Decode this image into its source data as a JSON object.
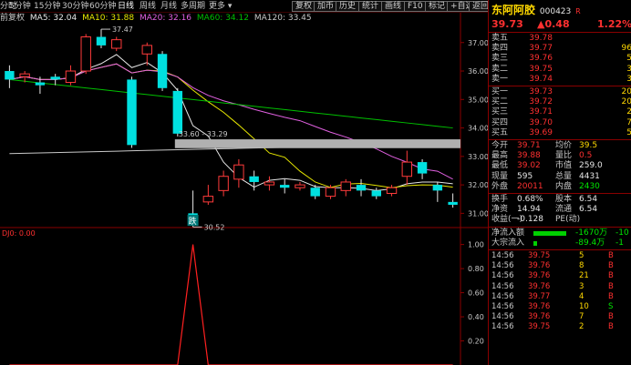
{
  "toolbar": {
    "periods": [
      "分时",
      "5分钟",
      "15分钟",
      "30分钟",
      "60分钟",
      "日线",
      "周线",
      "月线",
      "多周期",
      "更多"
    ],
    "active_period": "日线",
    "buttons": [
      "复权",
      "加币",
      "历史",
      "统计",
      "画线",
      "F10",
      "标记",
      "+自选",
      "返回"
    ]
  },
  "legend": {
    "prefix": "前复权",
    "ma5": "MA5: 32.04",
    "ma10": "MA10: 31.88",
    "ma20": "MA20: 32.16",
    "ma60": "MA60: 34.12",
    "ma120": "MA120: 33.45",
    "colors": {
      "ma5": "#e6e6e6",
      "ma10": "#e6e600",
      "ma20": "#e060e0",
      "ma60": "#00c000",
      "ma120": "#c8c8c8"
    }
  },
  "chart": {
    "price_ticks": [
      "37.00",
      "36.00",
      "35.00",
      "34.00",
      "33.00",
      "32.00",
      "31.00"
    ],
    "annotations": {
      "high": "37.47",
      "range": "33.60 - 33.29",
      "low": "30.52",
      "low_tag": "跌"
    },
    "sub_label": "DJ0: 0.00",
    "sub_ticks": [
      "1.00",
      "0.80",
      "0.60",
      "0.40",
      "0.20"
    ]
  },
  "chart_data": [
    {
      "type": "candlestick",
      "ylim": [
        30.5,
        37.6
      ],
      "candles": [
        {
          "o": 36.0,
          "c": 35.7,
          "h": 36.2,
          "l": 35.4
        },
        {
          "o": 35.8,
          "c": 35.9,
          "h": 36.0,
          "l": 35.6
        },
        {
          "o": 35.6,
          "c": 35.5,
          "h": 35.8,
          "l": 35.2
        },
        {
          "o": 35.8,
          "c": 35.7,
          "h": 35.9,
          "l": 35.5
        },
        {
          "o": 35.6,
          "c": 36.0,
          "h": 36.2,
          "l": 35.5
        },
        {
          "o": 36.0,
          "c": 37.2,
          "h": 37.3,
          "l": 35.9
        },
        {
          "o": 37.2,
          "c": 36.9,
          "h": 37.47,
          "l": 36.8
        },
        {
          "o": 36.8,
          "c": 37.1,
          "h": 37.2,
          "l": 36.7
        },
        {
          "o": 35.7,
          "c": 33.4,
          "h": 35.8,
          "l": 33.3
        },
        {
          "o": 36.6,
          "c": 36.9,
          "h": 37.0,
          "l": 36.2
        },
        {
          "o": 36.6,
          "c": 35.4,
          "h": 36.7,
          "l": 35.3
        },
        {
          "o": 35.3,
          "c": 33.8,
          "h": 35.4,
          "l": 33.7
        },
        {
          "o": 31.0,
          "c": 30.9,
          "h": 31.8,
          "l": 30.52
        },
        {
          "o": 31.4,
          "c": 31.6,
          "h": 32.0,
          "l": 31.3
        },
        {
          "o": 31.8,
          "c": 32.3,
          "h": 32.5,
          "l": 31.6
        },
        {
          "o": 32.2,
          "c": 32.7,
          "h": 32.9,
          "l": 31.9
        },
        {
          "o": 32.3,
          "c": 32.1,
          "h": 32.5,
          "l": 31.8
        },
        {
          "o": 32.0,
          "c": 32.1,
          "h": 32.3,
          "l": 31.8
        },
        {
          "o": 32.0,
          "c": 31.9,
          "h": 32.2,
          "l": 31.7
        },
        {
          "o": 31.9,
          "c": 32.0,
          "h": 32.1,
          "l": 31.8
        },
        {
          "o": 31.9,
          "c": 31.6,
          "h": 32.0,
          "l": 31.5
        },
        {
          "o": 31.6,
          "c": 31.9,
          "h": 32.0,
          "l": 31.5
        },
        {
          "o": 31.8,
          "c": 32.1,
          "h": 32.2,
          "l": 31.6
        },
        {
          "o": 32.0,
          "c": 31.8,
          "h": 32.2,
          "l": 31.6
        },
        {
          "o": 31.8,
          "c": 31.6,
          "h": 31.9,
          "l": 31.5
        },
        {
          "o": 31.7,
          "c": 31.9,
          "h": 32.0,
          "l": 31.6
        },
        {
          "o": 32.3,
          "c": 32.8,
          "h": 33.2,
          "l": 32.0
        },
        {
          "o": 32.8,
          "c": 32.4,
          "h": 32.9,
          "l": 32.2
        },
        {
          "o": 32.0,
          "c": 31.8,
          "h": 32.1,
          "l": 31.4
        },
        {
          "o": 31.4,
          "c": 31.3,
          "h": 31.7,
          "l": 31.2
        }
      ]
    },
    {
      "type": "line",
      "series": [
        {
          "name": "DJ0",
          "values": [
            0,
            0,
            0,
            0,
            0,
            0,
            0,
            0,
            0,
            0,
            0,
            0,
            1,
            0,
            0,
            0,
            0,
            0,
            0,
            0,
            0,
            0,
            0,
            0,
            0,
            0,
            0,
            0,
            0,
            0
          ]
        }
      ],
      "ylim": [
        0,
        1.05
      ]
    }
  ],
  "quote": {
    "name": "东阿阿胶",
    "code": "000423",
    "flag": "R",
    "price": "39.73",
    "change": "▲0.48",
    "pct": "1.22%",
    "asks": [
      {
        "label": "卖五",
        "price": "39.78",
        "vol": ""
      },
      {
        "label": "卖四",
        "price": "39.77",
        "vol": "96"
      },
      {
        "label": "卖三",
        "price": "39.76",
        "vol": "5"
      },
      {
        "label": "卖二",
        "price": "39.75",
        "vol": "3"
      },
      {
        "label": "卖一",
        "price": "39.74",
        "vol": "3"
      }
    ],
    "bids": [
      {
        "label": "买一",
        "price": "39.73",
        "vol": "20"
      },
      {
        "label": "买二",
        "price": "39.72",
        "vol": "20"
      },
      {
        "label": "买三",
        "price": "39.71",
        "vol": "2"
      },
      {
        "label": "买四",
        "price": "39.70",
        "vol": "7"
      },
      {
        "label": "买五",
        "price": "39.69",
        "vol": "5"
      }
    ],
    "stats": [
      {
        "l1": "今开",
        "v1": "39.71",
        "l2": "均价",
        "v2": "39.5"
      },
      {
        "l1": "最高",
        "v1": "39.88",
        "l2": "量比",
        "v2": "0.5"
      },
      {
        "l1": "最低",
        "v1": "39.02",
        "l2": "市值",
        "v2": "259.0"
      },
      {
        "l1": "现量",
        "v1": "595",
        "l2": "总量",
        "v2": "4431"
      },
      {
        "l1": "外盘",
        "v1": "20011",
        "l2": "内盘",
        "v2": "2430"
      }
    ],
    "stats2": [
      {
        "l1": "换手",
        "v1": "0.68%",
        "l2": "股本",
        "v2": "6.54"
      },
      {
        "l1": "净资",
        "v1": "14.94",
        "l2": "流通",
        "v2": "6.54"
      },
      {
        "l1": "收益(一)",
        "v1": "-0.128",
        "l2": "PE(动)",
        "v2": ""
      }
    ],
    "flows": [
      {
        "label": "净流入额",
        "value": "-1670万",
        "pct": "-10"
      },
      {
        "label": "大宗流入",
        "value": "-89.4万",
        "pct": "-1"
      }
    ],
    "ticks": [
      {
        "time": "14:56",
        "price": "39.75",
        "vol": "5",
        "side": "B"
      },
      {
        "time": "14:56",
        "price": "39.76",
        "vol": "8",
        "side": "B"
      },
      {
        "time": "14:56",
        "price": "39.76",
        "vol": "21",
        "side": "B"
      },
      {
        "time": "14:56",
        "price": "39.76",
        "vol": "3",
        "side": "B"
      },
      {
        "time": "14:56",
        "price": "39.77",
        "vol": "4",
        "side": "B"
      },
      {
        "time": "14:56",
        "price": "39.76",
        "vol": "10",
        "side": "S"
      },
      {
        "time": "14:56",
        "price": "39.76",
        "vol": "7",
        "side": "B"
      },
      {
        "time": "14:56",
        "price": "39.75",
        "vol": "2",
        "side": "B"
      }
    ]
  }
}
